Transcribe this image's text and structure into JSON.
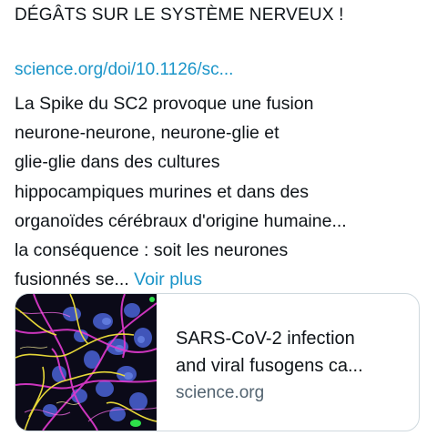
{
  "tweet": {
    "headline": "DÉGÂTS SUR LE SYSTÈME NERVEUX !",
    "link_text": "science.org/doi/10.1126/sc...",
    "body_lines": [
      "La Spike du SC2 provoque une fusion",
      "neurone-neurone, neurone-glie et",
      "glie-glie dans des cultures",
      "hippocampiques murines et dans des",
      "organoïdes cérébraux d'origine humaine...",
      "la conséquence : soit les neurones",
      "fusionnés se..."
    ],
    "voir_plus": "Voir plus"
  },
  "card": {
    "title_line1": "SARS-CoV-2 infection",
    "title_line2": "and viral fusogens ca...",
    "domain": "science.org",
    "thumbnail_icon": "neuron-microscopy-image"
  },
  "colors": {
    "link": "#1b95c9",
    "text": "#0f1419",
    "secondary": "#536471",
    "border": "#cfd9de"
  }
}
